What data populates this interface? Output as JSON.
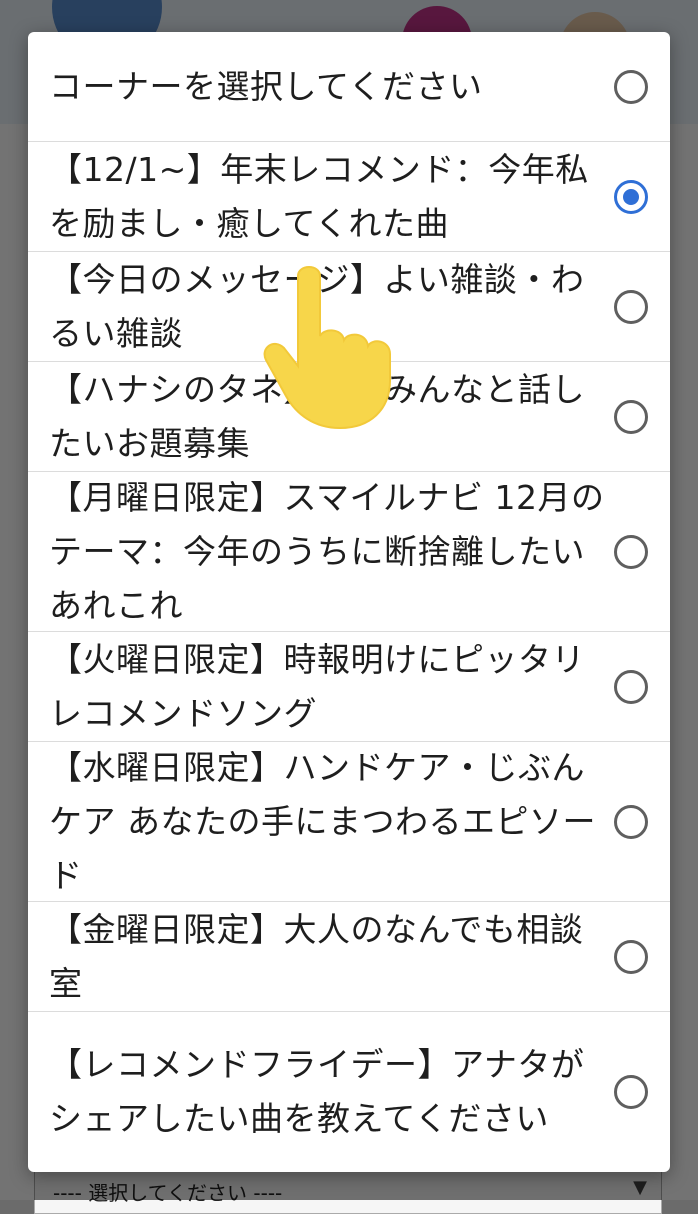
{
  "dialog": {
    "options": [
      {
        "label": "コーナーを選択してください",
        "selected": false
      },
      {
        "label": "【12/1~】年末レコメンド：今年私を励まし・癒してくれた曲",
        "selected": true
      },
      {
        "label": "【今日のメッセージ】よい雑談・わるい雑談",
        "selected": false
      },
      {
        "label": "【ハナシのタネ】今後みんなと話したいお題募集",
        "selected": false
      },
      {
        "label": "【月曜日限定】スマイルナビ 12月のテーマ：今年のうちに断捨離したいあれこれ",
        "selected": false
      },
      {
        "label": "【火曜日限定】時報明けにピッタリレコメンドソング",
        "selected": false
      },
      {
        "label": "【水曜日限定】ハンドケア・じぶんケア あなたの手にまつわるエピソード",
        "selected": false
      },
      {
        "label": "【金曜日限定】大人のなんでも相談室",
        "selected": false
      },
      {
        "label": "【レコメンドフライデー】アナタがシェアしたい曲を教えてください",
        "selected": false
      }
    ]
  },
  "background_select": {
    "label": "---- 選択してください ----",
    "arrow": "▼"
  },
  "colors": {
    "accent": "#2f6fd6",
    "overlay": "rgba(0,0,0,0.55)",
    "hand": "#f7d64a"
  },
  "icons": {
    "pointer": "hand-pointer-icon",
    "radio": "radio-button-icon"
  }
}
